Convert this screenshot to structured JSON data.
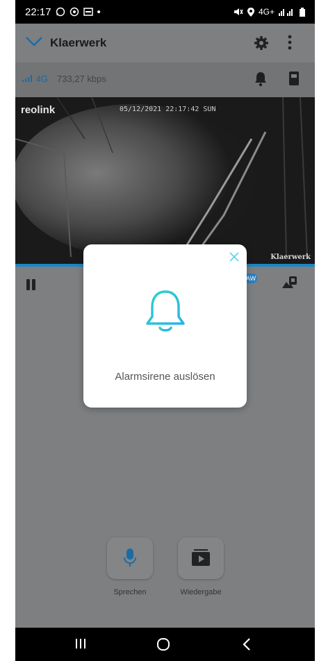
{
  "status_bar": {
    "time": "22:17",
    "network": "4G+"
  },
  "header": {
    "title": "Klaerwerk"
  },
  "connection": {
    "signal_label": "4G",
    "speed": "733,27 kbps"
  },
  "video": {
    "brand": "reolink",
    "timestamp": "05/12/2021 22:17:42 SUN",
    "camera_name": "Klaerwerk"
  },
  "controls": {
    "badge_text": "AW"
  },
  "features": [
    {
      "label": "Sprechen",
      "icon": "microphone-icon"
    },
    {
      "label": "Wiedergabe",
      "icon": "playback-icon"
    }
  ],
  "dialog": {
    "message": "Alarmsirene auslösen",
    "icon": "bell-icon",
    "accent": "#3cc8e8"
  },
  "colors": {
    "brand_blue": "#1a86c8",
    "overlay_grey": "#7d7f81"
  }
}
